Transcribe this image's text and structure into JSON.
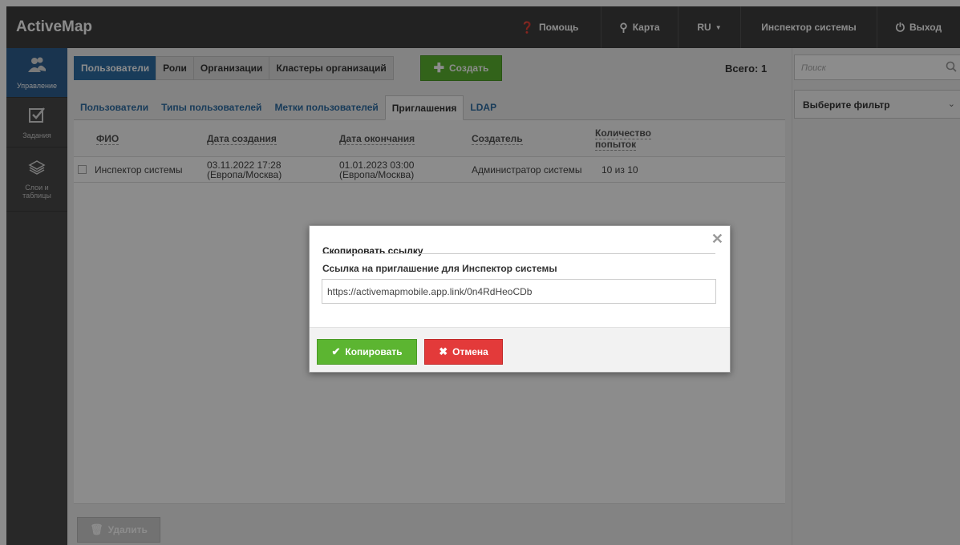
{
  "app": {
    "title": "ActiveMap"
  },
  "topbar": {
    "help": "Помощь",
    "map": "Карта",
    "lang": "RU",
    "user": "Инспектор системы",
    "logout": "Выход"
  },
  "leftnav": {
    "items": [
      {
        "label": "Управление",
        "icon": "users-icon"
      },
      {
        "label": "Задания",
        "icon": "checkbox-icon"
      },
      {
        "label": "Слои и таблицы",
        "icon": "layers-icon"
      }
    ]
  },
  "tabs_top": [
    "Пользователи",
    "Роли",
    "Организации",
    "Кластеры организаций"
  ],
  "create_label": "Создать",
  "total_label": "Всего: 1",
  "tabs_sub": [
    "Пользователи",
    "Типы пользователей",
    "Метки пользователей",
    "Приглашения",
    "LDAP"
  ],
  "table": {
    "headers": [
      "ФИО",
      "Дата создания",
      "Дата окончания",
      "Создатель",
      "Количество попыток"
    ],
    "rows": [
      {
        "name": "Инспектор системы",
        "created_date": "03.11.2022 17:28",
        "created_tz": "(Европа/Москва)",
        "end_date": "01.01.2023 03:00",
        "end_tz": "(Европа/Москва)",
        "creator": "Администратор системы",
        "attempts": "10 из 10"
      }
    ]
  },
  "delete_label": "Удалить",
  "search": {
    "placeholder": "Поиск"
  },
  "filter": {
    "label": "Выберите фильтр"
  },
  "modal": {
    "title": "Скопировать ссылку",
    "label": "Ссылка на приглашение для Инспектор системы",
    "link": "https://activemapmobile.app.link/0n4RdHeoCDb",
    "copy_label": "Копировать",
    "cancel_label": "Отмена"
  },
  "colors": {
    "accent": "#2e6da4",
    "success": "#5cb531",
    "danger": "#e33a3a",
    "topbar": "#3f3f3f"
  }
}
